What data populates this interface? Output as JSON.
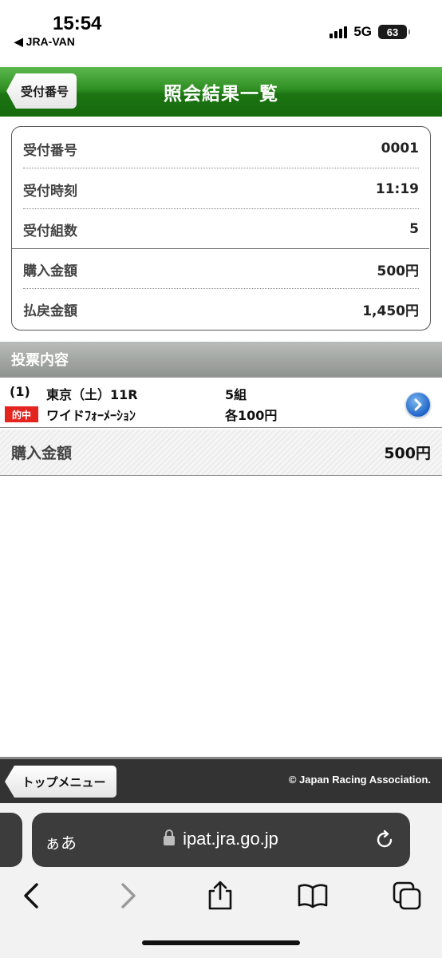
{
  "status_bar": {
    "time": "15:54",
    "back_app": "◀ JRA-VAN",
    "network": "5G",
    "battery": "63",
    "icons": [
      "signal-icon",
      "battery-icon"
    ]
  },
  "header": {
    "back_label": "受付番号",
    "title": "照会結果一覧",
    "colors": {
      "green_top": "#5cb84f",
      "green_bottom": "#156a0c"
    }
  },
  "summary": {
    "rows": [
      {
        "label": "受付番号",
        "value": "0001"
      },
      {
        "label": "受付時刻",
        "value": "11:19"
      },
      {
        "label": "受付組数",
        "value": "5"
      },
      {
        "label": "購入金額",
        "value": "500円"
      },
      {
        "label": "払戻金額",
        "value": "1,450円"
      }
    ]
  },
  "section": {
    "title": "投票内容"
  },
  "bets": [
    {
      "number": "(1)",
      "race": "東京（土）11R",
      "combinations": "5組",
      "badge": "的中",
      "type": "ワイドﾌｫｰﾒｰｼｮﾝ",
      "amount": "各100円",
      "icon": "chevron-right-icon"
    }
  ],
  "total": {
    "label": "購入金額",
    "value": "500円"
  },
  "footer": {
    "top_menu_label": "トップメニュー",
    "copyright": "© Japan Racing Association."
  },
  "safari": {
    "aa_label": "ぁあ",
    "url": "ipat.jra.go.jp",
    "icons": [
      "lock-icon",
      "reload-icon",
      "back-icon",
      "forward-icon",
      "share-icon",
      "bookmarks-icon",
      "tabs-icon"
    ]
  }
}
